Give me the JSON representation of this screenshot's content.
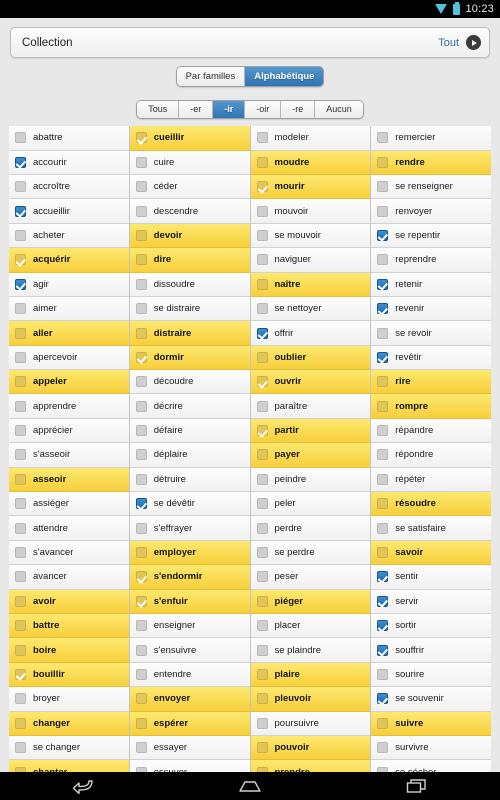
{
  "statusbar": {
    "time": "10:23",
    "wifi_icon": "wifi-icon",
    "battery_icon": "battery-icon"
  },
  "header": {
    "title": "Collection",
    "action_label": "Tout",
    "chevron_icon": "chevron-right-icon"
  },
  "sort_tabs": [
    {
      "label": "Par familles",
      "active": false
    },
    {
      "label": "Alphabétique",
      "active": true
    }
  ],
  "group_tabs": [
    {
      "label": "Tous",
      "active": false
    },
    {
      "label": "-er",
      "active": false
    },
    {
      "label": "-ir",
      "active": true
    },
    {
      "label": "-oir",
      "active": false
    },
    {
      "label": "-re",
      "active": false
    },
    {
      "label": "Aucun",
      "active": false
    }
  ],
  "colors": {
    "accent_blue": "#2f74b4",
    "highlight_yellow": "#f7cf3c",
    "status_cyan": "#4fc3da",
    "row_background": "#f6f6f6"
  },
  "columns": [
    {
      "items": [
        {
          "label": "abattre",
          "checked": false,
          "highlighted": false
        },
        {
          "label": "accourir",
          "checked": true,
          "highlighted": false
        },
        {
          "label": "accroître",
          "checked": false,
          "highlighted": false
        },
        {
          "label": "accueillir",
          "checked": true,
          "highlighted": false
        },
        {
          "label": "acheter",
          "checked": false,
          "highlighted": false
        },
        {
          "label": "acquérir",
          "checked": true,
          "highlighted": true
        },
        {
          "label": "agir",
          "checked": true,
          "highlighted": false
        },
        {
          "label": "aimer",
          "checked": false,
          "highlighted": false
        },
        {
          "label": "aller",
          "checked": false,
          "highlighted": true
        },
        {
          "label": "apercevoir",
          "checked": false,
          "highlighted": false
        },
        {
          "label": "appeler",
          "checked": false,
          "highlighted": true
        },
        {
          "label": "apprendre",
          "checked": false,
          "highlighted": false
        },
        {
          "label": "apprécier",
          "checked": false,
          "highlighted": false
        },
        {
          "label": "s'asseoir",
          "checked": false,
          "highlighted": false
        },
        {
          "label": "asseoir",
          "checked": false,
          "highlighted": true
        },
        {
          "label": "assiéger",
          "checked": false,
          "highlighted": false
        },
        {
          "label": "attendre",
          "checked": false,
          "highlighted": false
        },
        {
          "label": "s'avancer",
          "checked": false,
          "highlighted": false
        },
        {
          "label": "avancer",
          "checked": false,
          "highlighted": false
        },
        {
          "label": "avoir",
          "checked": false,
          "highlighted": true
        },
        {
          "label": "battre",
          "checked": false,
          "highlighted": true
        },
        {
          "label": "boire",
          "checked": false,
          "highlighted": true
        },
        {
          "label": "bouillir",
          "checked": true,
          "highlighted": true
        },
        {
          "label": "broyer",
          "checked": false,
          "highlighted": false
        },
        {
          "label": "changer",
          "checked": false,
          "highlighted": true
        },
        {
          "label": "se changer",
          "checked": false,
          "highlighted": false
        },
        {
          "label": "chanter",
          "checked": false,
          "highlighted": true
        }
      ]
    },
    {
      "items": [
        {
          "label": "cueillir",
          "checked": true,
          "highlighted": true
        },
        {
          "label": "cuire",
          "checked": false,
          "highlighted": false
        },
        {
          "label": "céder",
          "checked": false,
          "highlighted": false
        },
        {
          "label": "descendre",
          "checked": false,
          "highlighted": false
        },
        {
          "label": "devoir",
          "checked": false,
          "highlighted": true
        },
        {
          "label": "dire",
          "checked": false,
          "highlighted": true
        },
        {
          "label": "dissoudre",
          "checked": false,
          "highlighted": false
        },
        {
          "label": "se distraire",
          "checked": false,
          "highlighted": false
        },
        {
          "label": "distraire",
          "checked": false,
          "highlighted": true
        },
        {
          "label": "dormir",
          "checked": true,
          "highlighted": true
        },
        {
          "label": "découdre",
          "checked": false,
          "highlighted": false
        },
        {
          "label": "décrire",
          "checked": false,
          "highlighted": false
        },
        {
          "label": "défaire",
          "checked": false,
          "highlighted": false
        },
        {
          "label": "déplaire",
          "checked": false,
          "highlighted": false
        },
        {
          "label": "détruire",
          "checked": false,
          "highlighted": false
        },
        {
          "label": "se dévêtir",
          "checked": true,
          "highlighted": false
        },
        {
          "label": "s'effrayer",
          "checked": false,
          "highlighted": false
        },
        {
          "label": "employer",
          "checked": false,
          "highlighted": true
        },
        {
          "label": "s'endormir",
          "checked": true,
          "highlighted": true
        },
        {
          "label": "s'enfuir",
          "checked": true,
          "highlighted": true
        },
        {
          "label": "enseigner",
          "checked": false,
          "highlighted": false
        },
        {
          "label": "s'ensuivre",
          "checked": false,
          "highlighted": false
        },
        {
          "label": "entendre",
          "checked": false,
          "highlighted": false
        },
        {
          "label": "envoyer",
          "checked": false,
          "highlighted": true
        },
        {
          "label": "espérer",
          "checked": false,
          "highlighted": true
        },
        {
          "label": "essayer",
          "checked": false,
          "highlighted": false
        },
        {
          "label": "essuyer",
          "checked": false,
          "highlighted": false
        }
      ]
    },
    {
      "items": [
        {
          "label": "modeler",
          "checked": false,
          "highlighted": false
        },
        {
          "label": "moudre",
          "checked": false,
          "highlighted": true
        },
        {
          "label": "mourir",
          "checked": true,
          "highlighted": true
        },
        {
          "label": "mouvoir",
          "checked": false,
          "highlighted": false
        },
        {
          "label": "se mouvoir",
          "checked": false,
          "highlighted": false
        },
        {
          "label": "naviguer",
          "checked": false,
          "highlighted": false
        },
        {
          "label": "naître",
          "checked": false,
          "highlighted": true
        },
        {
          "label": "se nettoyer",
          "checked": false,
          "highlighted": false
        },
        {
          "label": "offrir",
          "checked": true,
          "highlighted": false
        },
        {
          "label": "oublier",
          "checked": false,
          "highlighted": true
        },
        {
          "label": "ouvrir",
          "checked": true,
          "highlighted": true
        },
        {
          "label": "paraître",
          "checked": false,
          "highlighted": false
        },
        {
          "label": "partir",
          "checked": true,
          "highlighted": true
        },
        {
          "label": "payer",
          "checked": false,
          "highlighted": true
        },
        {
          "label": "peindre",
          "checked": false,
          "highlighted": false
        },
        {
          "label": "peler",
          "checked": false,
          "highlighted": false
        },
        {
          "label": "perdre",
          "checked": false,
          "highlighted": false
        },
        {
          "label": "se perdre",
          "checked": false,
          "highlighted": false
        },
        {
          "label": "peser",
          "checked": false,
          "highlighted": false
        },
        {
          "label": "piéger",
          "checked": false,
          "highlighted": true
        },
        {
          "label": "placer",
          "checked": false,
          "highlighted": false
        },
        {
          "label": "se plaindre",
          "checked": false,
          "highlighted": false
        },
        {
          "label": "plaire",
          "checked": false,
          "highlighted": true
        },
        {
          "label": "pleuvoir",
          "checked": false,
          "highlighted": true
        },
        {
          "label": "poursuivre",
          "checked": false,
          "highlighted": false
        },
        {
          "label": "pouvoir",
          "checked": false,
          "highlighted": true
        },
        {
          "label": "prendre",
          "checked": false,
          "highlighted": true
        }
      ]
    },
    {
      "items": [
        {
          "label": "remercier",
          "checked": false,
          "highlighted": false
        },
        {
          "label": "rendre",
          "checked": false,
          "highlighted": true
        },
        {
          "label": "se renseigner",
          "checked": false,
          "highlighted": false
        },
        {
          "label": "renvoyer",
          "checked": false,
          "highlighted": false
        },
        {
          "label": "se repentir",
          "checked": true,
          "highlighted": false
        },
        {
          "label": "reprendre",
          "checked": false,
          "highlighted": false
        },
        {
          "label": "retenir",
          "checked": true,
          "highlighted": false
        },
        {
          "label": "revenir",
          "checked": true,
          "highlighted": false
        },
        {
          "label": "se revoir",
          "checked": false,
          "highlighted": false
        },
        {
          "label": "revêtir",
          "checked": true,
          "highlighted": false
        },
        {
          "label": "rire",
          "checked": false,
          "highlighted": true
        },
        {
          "label": "rompre",
          "checked": false,
          "highlighted": true
        },
        {
          "label": "répandre",
          "checked": false,
          "highlighted": false
        },
        {
          "label": "répondre",
          "checked": false,
          "highlighted": false
        },
        {
          "label": "répéter",
          "checked": false,
          "highlighted": false
        },
        {
          "label": "résoudre",
          "checked": false,
          "highlighted": true
        },
        {
          "label": "se satisfaire",
          "checked": false,
          "highlighted": false
        },
        {
          "label": "savoir",
          "checked": false,
          "highlighted": true
        },
        {
          "label": "sentir",
          "checked": true,
          "highlighted": false
        },
        {
          "label": "servir",
          "checked": true,
          "highlighted": false
        },
        {
          "label": "sortir",
          "checked": true,
          "highlighted": false
        },
        {
          "label": "souffrir",
          "checked": true,
          "highlighted": false
        },
        {
          "label": "sourire",
          "checked": false,
          "highlighted": false
        },
        {
          "label": "se souvenir",
          "checked": true,
          "highlighted": false
        },
        {
          "label": "suivre",
          "checked": false,
          "highlighted": true
        },
        {
          "label": "survivre",
          "checked": false,
          "highlighted": false
        },
        {
          "label": "se sécher",
          "checked": false,
          "highlighted": false
        }
      ]
    }
  ],
  "navbar": [
    {
      "icon": "back-icon"
    },
    {
      "icon": "home-icon"
    },
    {
      "icon": "recent-apps-icon"
    }
  ]
}
